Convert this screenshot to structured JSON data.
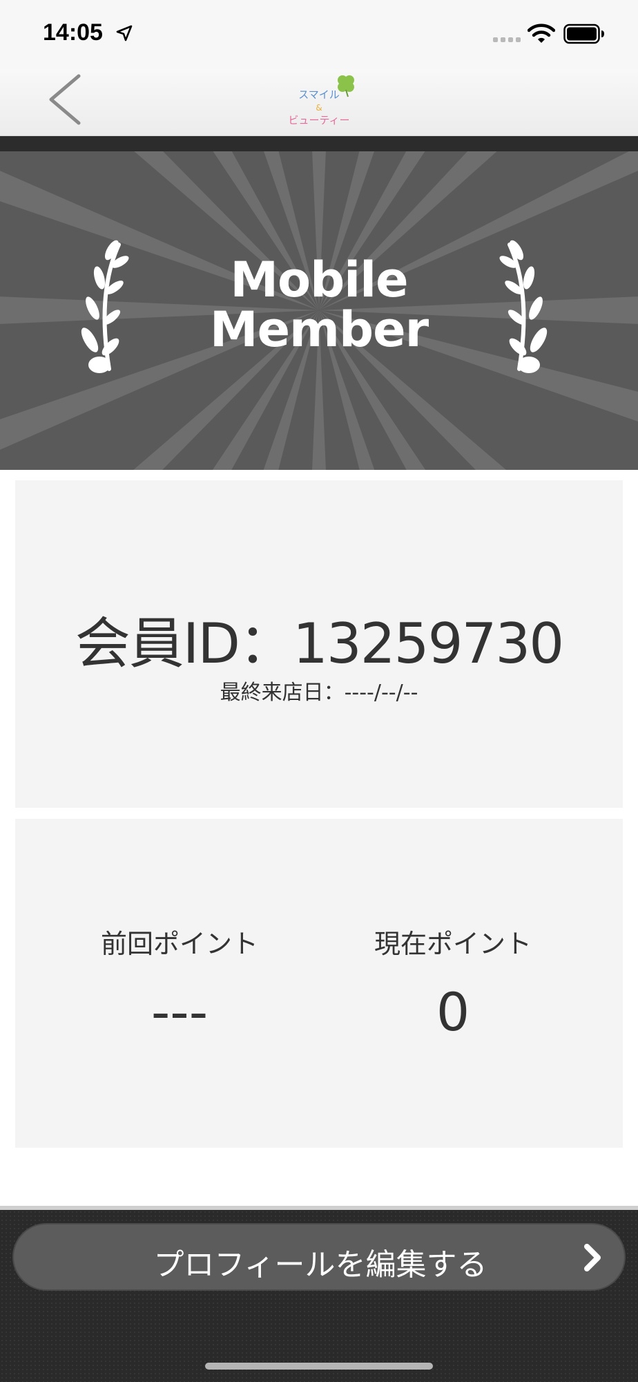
{
  "status_bar": {
    "time": "14:05",
    "icons": [
      "location-arrow-icon",
      "cellular-signal-icon",
      "wifi-icon",
      "battery-icon"
    ]
  },
  "nav": {
    "back_icon": "chevron-left-icon",
    "logo": {
      "line1": "スマイル",
      "line2": "&",
      "line3": "ビューティー",
      "icon": "clover-icon"
    }
  },
  "hero": {
    "title_line1": "Mobile",
    "title_line2": "Member",
    "decor_icons": [
      "laurel-left-icon",
      "laurel-right-icon"
    ]
  },
  "member": {
    "id_label": "会員ID：13259730",
    "last_visit": "最終来店日：----/--/--"
  },
  "points": {
    "previous_label": "前回ポイント",
    "previous_value": "---",
    "current_label": "現在ポイント",
    "current_value": "0"
  },
  "footer": {
    "edit_profile_label": "プロフィールを編集する",
    "edit_profile_icon": "chevron-right-icon"
  },
  "colors": {
    "hero_bg": "#5a5a5a",
    "card_bg": "#f4f4f4",
    "button_bg": "#5c5c5c",
    "footer_bg": "#2a2a2a",
    "text": "#333333"
  }
}
